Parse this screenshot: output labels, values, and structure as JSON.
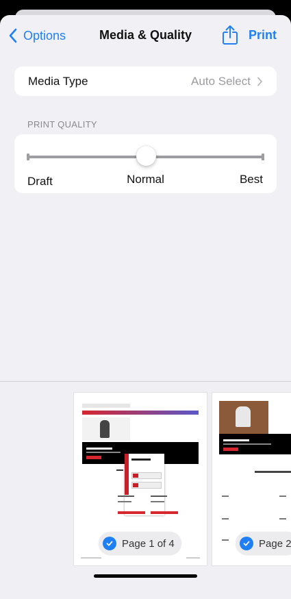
{
  "nav": {
    "back_label": "Options",
    "title": "Media & Quality",
    "print_label": "Print"
  },
  "media": {
    "label": "Media Type",
    "value": "Auto Select"
  },
  "quality": {
    "section_header": "PRINT QUALITY",
    "labels": [
      "Draft",
      "Normal",
      "Best"
    ],
    "selected": "Normal",
    "level": 0.5
  },
  "pages": [
    {
      "label": "Page 1 of 4",
      "selected": true
    },
    {
      "label": "Page 2",
      "selected": true
    }
  ],
  "colors": {
    "accent": "#1f7ff5",
    "background": "#f0f0f5"
  }
}
